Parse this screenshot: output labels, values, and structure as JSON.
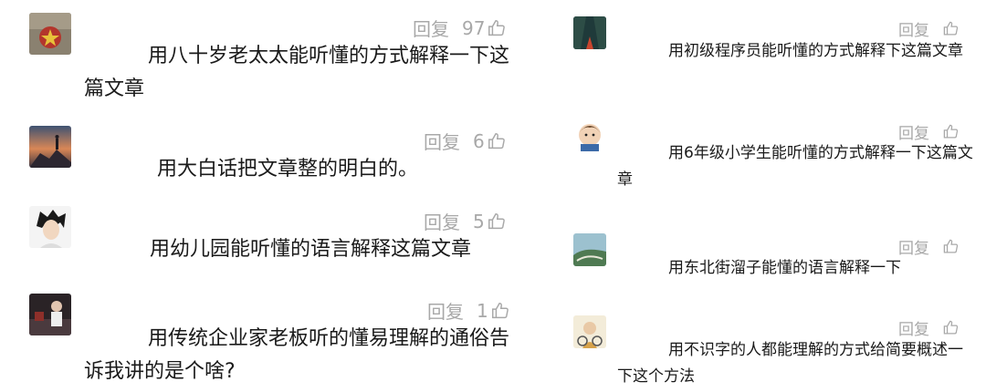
{
  "left_comments": [
    {
      "reply_label": "回复",
      "like_count": "97",
      "text": "用八十岁老太太能听懂的方式解释一下这篇文章"
    },
    {
      "reply_label": "回复",
      "like_count": "6",
      "text": "用大白话把文章整的明白的。"
    },
    {
      "reply_label": "回复",
      "like_count": "5",
      "text": "用幼儿园能听懂的语言解释这篇文章"
    },
    {
      "reply_label": "回复",
      "like_count": "1",
      "text": "用传统企业家老板听的懂易理解的通俗告诉我讲的是个啥?"
    }
  ],
  "right_comments": [
    {
      "reply_label": "回复",
      "text": "用初级程序员能听懂的方式解释下这篇文章"
    },
    {
      "reply_label": "回复",
      "text": "用6年级小学生能听懂的方式解释一下这篇文章"
    },
    {
      "reply_label": "回复",
      "text": "用东北街溜子能懂的语言解释一下"
    },
    {
      "reply_label": "回复",
      "text": "用不识字的人都能理解的方式给简要概述一下这个方法"
    }
  ],
  "icons": {
    "like": "thumbs-up-outline-icon"
  },
  "colors": {
    "text": "#1a1a1a",
    "meta": "#a8a8a8",
    "background": "#ffffff"
  }
}
